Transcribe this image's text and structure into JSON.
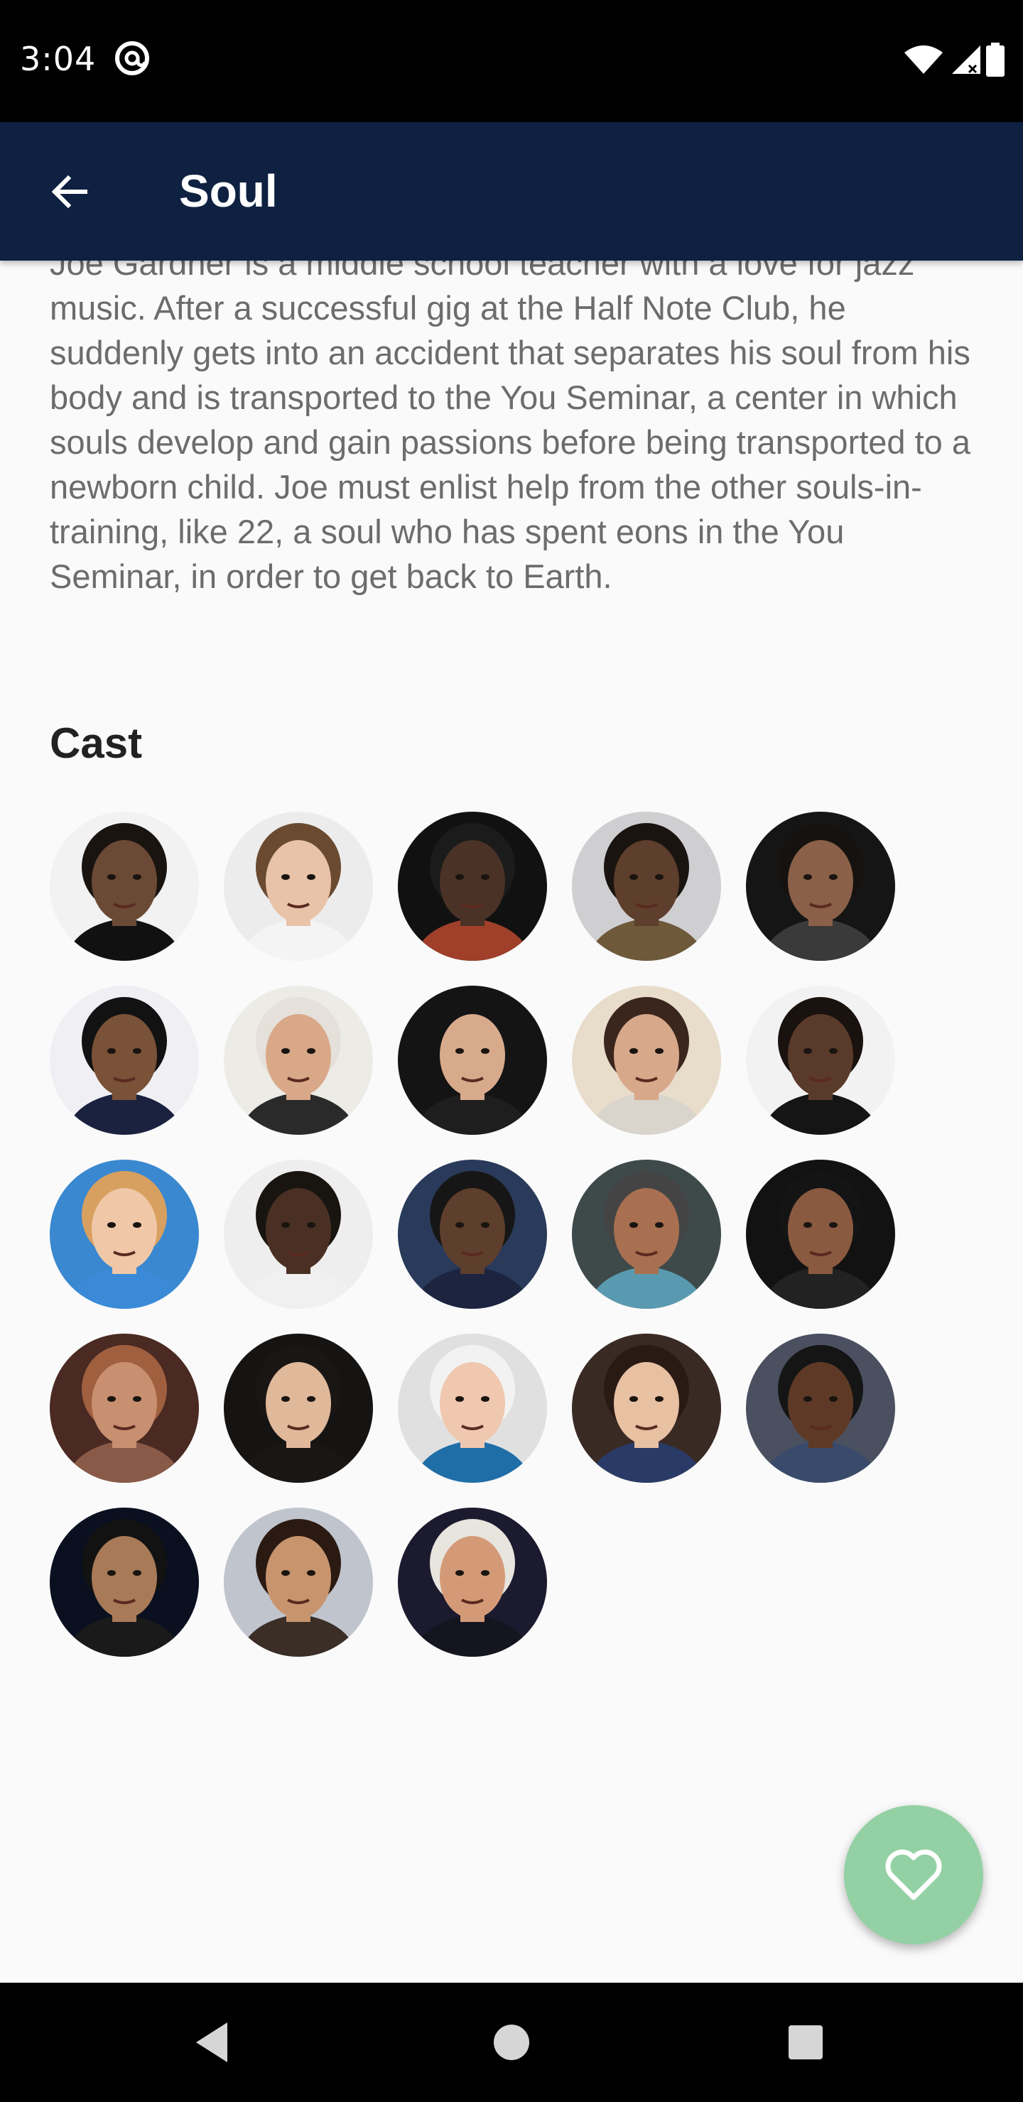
{
  "status_bar": {
    "time": "3:04",
    "icons": [
      "at-sign-icon",
      "wifi-icon",
      "signal-icon",
      "battery-icon"
    ]
  },
  "app_bar": {
    "title": "Soul",
    "back_icon": "arrow-back-icon",
    "color": "#0e2141"
  },
  "overview": {
    "text": "Joe Gardner is a middle school teacher with a love for jazz music. After a successful gig at the Half Note Club, he suddenly gets into an accident that separates his soul from his body and is transported to the You Seminar, a center in which souls develop and gain passions before being transported to a newborn child. Joe must enlist help from the other souls-in-training, like 22, a soul who has spent eons in the You Seminar, in order to get back to Earth."
  },
  "cast": {
    "title": "Cast",
    "members": [
      {
        "skin": "#6b4a35",
        "hair": "#1a1410",
        "bg": "#f2f2f2",
        "shirt": "#111111"
      },
      {
        "skin": "#e8c3a8",
        "hair": "#6a4a30",
        "bg": "#ececec",
        "shirt": "#f4f4f4"
      },
      {
        "skin": "#4a3226",
        "hair": "#1b1b1b",
        "bg": "#111111",
        "shirt": "#a0402a"
      },
      {
        "skin": "#5e3e2c",
        "hair": "#1a1410",
        "bg": "#cfcfd2",
        "shirt": "#6e5a3a"
      },
      {
        "skin": "#8a6048",
        "hair": "#161210",
        "bg": "#151515",
        "shirt": "#3a3a3a"
      },
      {
        "skin": "#7a5238",
        "hair": "#121212",
        "bg": "#f0f0f4",
        "shirt": "#1a2240"
      },
      {
        "skin": "#d9a888",
        "hair": "#e5e0da",
        "bg": "#ecebe6",
        "shirt": "#2a2a2a"
      },
      {
        "skin": "#d8aa8c",
        "hair": "#141414",
        "bg": "#141414",
        "shirt": "#1e1e1e"
      },
      {
        "skin": "#d8a88a",
        "hair": "#3a261c",
        "bg": "#e8dccb",
        "shirt": "#d9d4cc"
      },
      {
        "skin": "#5a3a2a",
        "hair": "#1a120e",
        "bg": "#f2f2f2",
        "shirt": "#151515"
      },
      {
        "skin": "#f0c8a8",
        "hair": "#d8a060",
        "bg": "#3a88d0",
        "shirt": "#3a8ad8"
      },
      {
        "skin": "#4a3024",
        "hair": "#181410",
        "bg": "#eeeeee",
        "shirt": "#f0f0f0"
      },
      {
        "skin": "#5e3e2c",
        "hair": "#161616",
        "bg": "#2a3a5a",
        "shirt": "#1c2440"
      },
      {
        "skin": "#a87050",
        "hair": "#444444",
        "bg": "#3e4a4a",
        "shirt": "#5a9ab0"
      },
      {
        "skin": "#8a5a40",
        "hair": "#141414",
        "bg": "#121212",
        "shirt": "#222222"
      },
      {
        "skin": "#c89070",
        "hair": "#a06040",
        "bg": "#4a2a22",
        "shirt": "#8a5a48"
      },
      {
        "skin": "#e0b89a",
        "hair": "#1a1614",
        "bg": "#161412",
        "shirt": "#1a1614"
      },
      {
        "skin": "#f0c8b0",
        "hair": "#f2f2f2",
        "bg": "#e0e0e0",
        "shirt": "#1f6ea8"
      },
      {
        "skin": "#e8c0a2",
        "hair": "#2a1a14",
        "bg": "#3a2a24",
        "shirt": "#2a3a66"
      },
      {
        "skin": "#5e3a26",
        "hair": "#151515",
        "bg": "#4a5060",
        "shirt": "#3a4a6a"
      },
      {
        "skin": "#a87a58",
        "hair": "#121212",
        "bg": "#0a1020",
        "shirt": "#1a1a1a"
      },
      {
        "skin": "#c8946e",
        "hair": "#2a1a12",
        "bg": "#c0c4cc",
        "shirt": "#3a2e26"
      },
      {
        "skin": "#d49a78",
        "hair": "#e8e4de",
        "bg": "#1c1a2e",
        "shirt": "#151520"
      }
    ]
  },
  "fab": {
    "icon": "heart-icon",
    "color": "#93d1a4"
  },
  "nav_bar": {
    "icons": [
      "back-triangle-icon",
      "home-circle-icon",
      "recents-square-icon"
    ]
  }
}
